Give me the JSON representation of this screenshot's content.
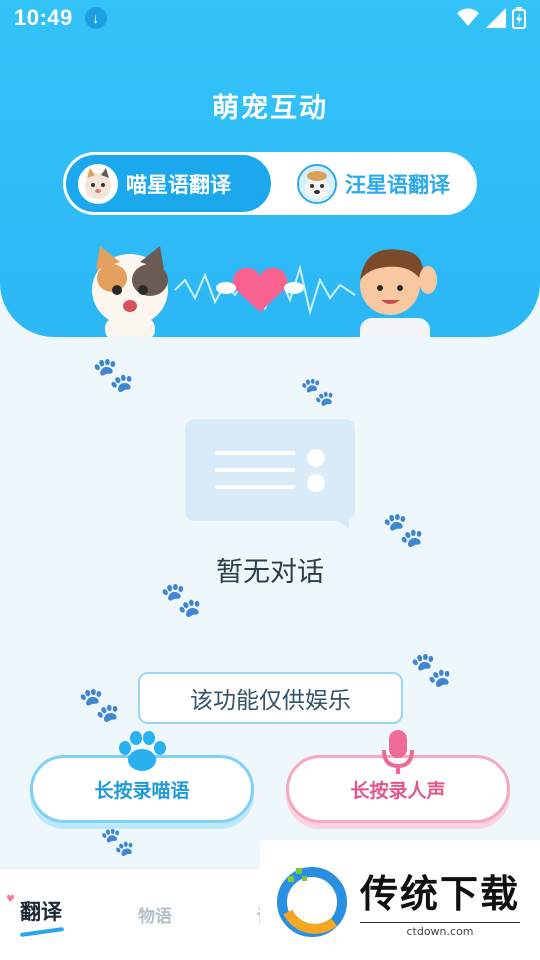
{
  "status_bar": {
    "time": "10:49",
    "download_icon": "download-arrow-icon",
    "wifi_icon": "wifi-icon",
    "signal_icon": "signal-icon",
    "battery_icon": "battery-charging-icon"
  },
  "header": {
    "title": "萌宠互动",
    "tabs": [
      {
        "label": "喵星语翻译",
        "avatar": "cat-avatar-icon",
        "active": true
      },
      {
        "label": "汪星语翻译",
        "avatar": "dog-avatar-icon",
        "active": false
      }
    ]
  },
  "empty_state": {
    "text": "暂无对话"
  },
  "notice": "该功能仅供娱乐",
  "actions": {
    "cat_button": "长按录喵语",
    "human_button": "长按录人声"
  },
  "bottom_nav": {
    "items": [
      {
        "label": "翻译",
        "active": true
      },
      {
        "label": "物语",
        "active": false
      },
      {
        "label": "记",
        "active": false
      }
    ]
  },
  "watermark": {
    "title": "传统下载",
    "url": "ctdown.com"
  },
  "colors": {
    "primary_blue": "#2cb7f5",
    "active_tab": "#1ba8ec",
    "pink_accent": "#e0588a"
  }
}
